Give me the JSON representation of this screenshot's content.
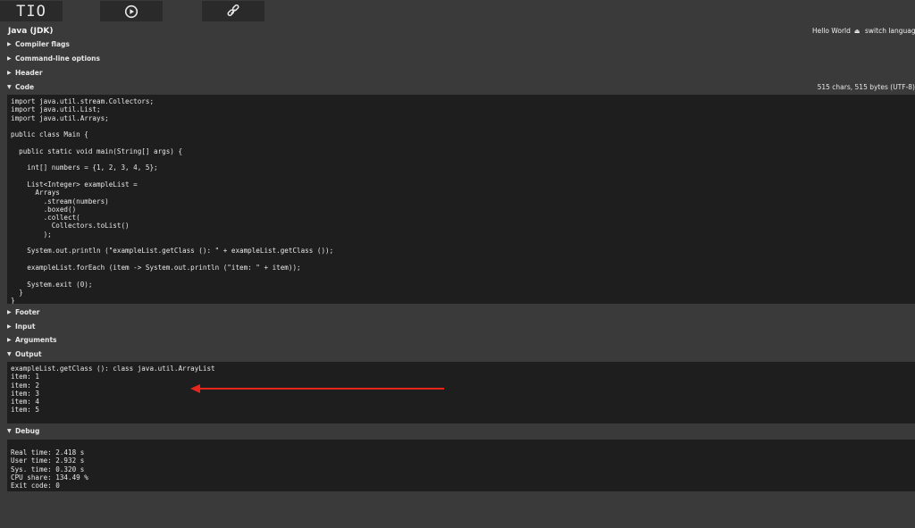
{
  "toolbar": {
    "logo_text": "TIO"
  },
  "header": {
    "language": "Java (JDK)",
    "hello_world": "Hello World",
    "switch_language": "switch language"
  },
  "sections": {
    "compiler_flags": "Compiler flags",
    "command_line_options": "Command-line options",
    "header": "Header",
    "code": "Code",
    "code_meta": "515 chars, 515 bytes (UTF-8)",
    "footer": "Footer",
    "input": "Input",
    "arguments": "Arguments",
    "output": "Output",
    "debug": "Debug"
  },
  "code": "import java.util.stream.Collectors;\nimport java.util.List;\nimport java.util.Arrays;\n\npublic class Main {\n\n  public static void main(String[] args) {\n\n    int[] numbers = {1, 2, 3, 4, 5};\n\n    List<Integer> exampleList =\n      Arrays\n        .stream(numbers)\n        .boxed()\n        .collect(\n          Collectors.toList()\n        );\n\n    System.out.println (\"exampleList.getClass (): \" + exampleList.getClass ());\n\n    exampleList.forEach (item -> System.out.println (\"item: \" + item));\n\n    System.exit (0);\n  }\n}",
  "output": "exampleList.getClass (): class java.util.ArrayList\nitem: 1\nitem: 2\nitem: 3\nitem: 4\nitem: 5",
  "debug": "Real time: 2.418 s\nUser time: 2.932 s\nSys. time: 0.320 s\nCPU share: 134.49 %\nExit code: 0",
  "colors": {
    "background": "#3a3a3a",
    "panel": "#1e1e1e",
    "arrow": "#e8261c"
  },
  "icons": {
    "run": "play-circle-icon",
    "permalink": "chain-link-icon"
  }
}
